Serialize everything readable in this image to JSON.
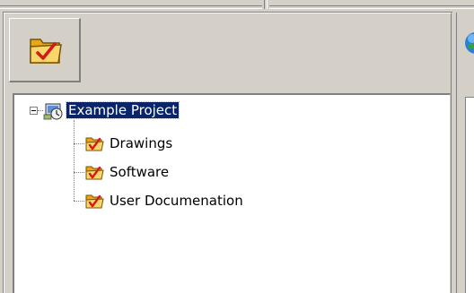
{
  "toolbar": {
    "open_project_icon": "folder-checkmark-icon"
  },
  "tree": {
    "root": {
      "label": "Example Project",
      "icon": "project-icon",
      "expanded": true,
      "selected": true
    },
    "children": [
      {
        "label": "Drawings",
        "icon": "folder-checkmark-icon"
      },
      {
        "label": "Software",
        "icon": "folder-checkmark-icon"
      },
      {
        "label": "User Documenation",
        "icon": "folder-checkmark-icon"
      }
    ]
  },
  "colors": {
    "window_bg": "#d4d0c8",
    "selection_bg": "#0a246a",
    "folder_yellow": "#f3c53a",
    "check_red": "#d21a1a"
  }
}
